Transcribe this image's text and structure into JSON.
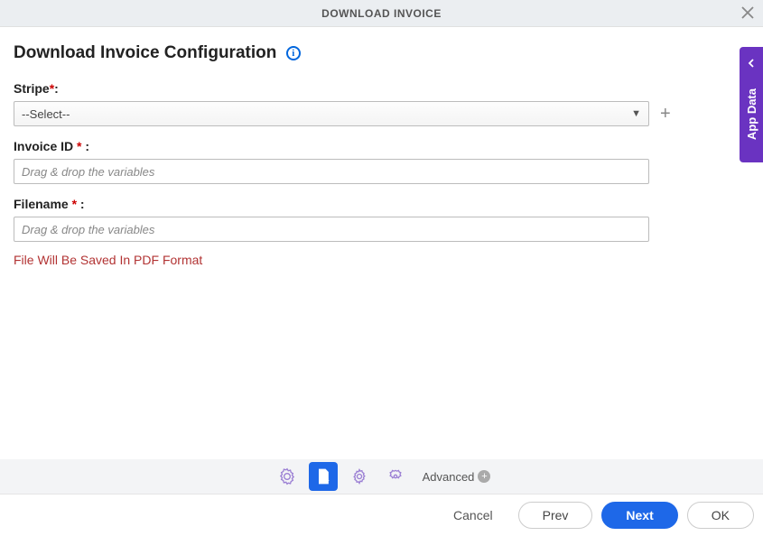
{
  "header": {
    "title": "DOWNLOAD INVOICE"
  },
  "page": {
    "heading": "Download Invoice Configuration"
  },
  "fields": {
    "stripe": {
      "label": "Stripe",
      "required": "*",
      "suffix": ":",
      "selected": "--Select--"
    },
    "invoice_id": {
      "label": "Invoice ID ",
      "required": "*",
      "suffix": " :",
      "placeholder": "Drag & drop the variables"
    },
    "filename": {
      "label": "Filename ",
      "required": "*",
      "suffix": " :",
      "placeholder": "Drag & drop the variables"
    },
    "hint": "File Will Be Saved In PDF Format"
  },
  "toolbar": {
    "advanced": "Advanced"
  },
  "footer": {
    "cancel": "Cancel",
    "prev": "Prev",
    "next": "Next",
    "ok": "OK"
  },
  "side_panel": {
    "label": "App Data"
  }
}
